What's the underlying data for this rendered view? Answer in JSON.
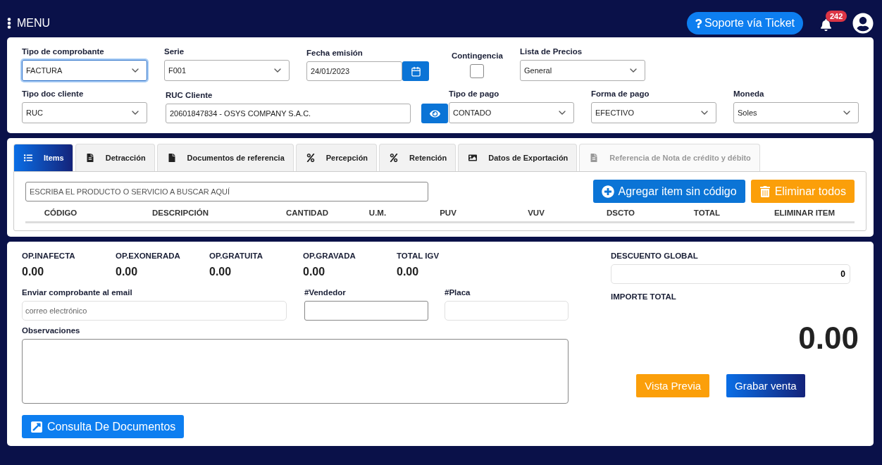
{
  "header": {
    "menu_label": "MENU",
    "support_button": "Soporte vía Ticket",
    "notifications_count": "242"
  },
  "form": {
    "rows": [
      [
        {
          "kind": "select",
          "label": "Tipo de comprobante",
          "value": "FACTURA",
          "focused": true
        },
        {
          "kind": "select",
          "label": "Serie",
          "value": "F001",
          "focused": false
        },
        {
          "kind": "date",
          "label": "Fecha emisión",
          "value": "24/01/2023"
        },
        {
          "kind": "checkbox",
          "label": "Contingencia",
          "checked": false
        },
        {
          "kind": "select",
          "label": "Lista de Precios",
          "value": "General",
          "focused": false
        }
      ],
      [
        {
          "kind": "select",
          "label": "Tipo doc cliente",
          "value": "RUC",
          "focused": false
        },
        {
          "kind": "text",
          "label": "RUC Cliente",
          "value": "20601847834 - OSYS COMPANY S.A.C."
        },
        {
          "kind": "eye-button"
        },
        {
          "kind": "select",
          "label": "Tipo de pago",
          "value": "CONTADO",
          "focused": false
        },
        {
          "kind": "select",
          "label": "Forma de pago",
          "value": "EFECTIVO",
          "focused": false
        },
        {
          "kind": "select",
          "label": "Moneda",
          "value": "Soles",
          "focused": false
        }
      ]
    ]
  },
  "tabs": [
    {
      "kind": "list",
      "label": "Items",
      "selected": true,
      "disabled": false
    },
    {
      "kind": "doc",
      "label": "Detracción",
      "selected": false,
      "disabled": false
    },
    {
      "kind": "file",
      "label": "Documentos de referencia",
      "selected": false,
      "disabled": false
    },
    {
      "kind": "percent",
      "label": "Percepción",
      "selected": false,
      "disabled": false
    },
    {
      "kind": "percent",
      "label": "Retención",
      "selected": false,
      "disabled": false
    },
    {
      "kind": "image",
      "label": "Datos de Exportación",
      "selected": false,
      "disabled": false
    },
    {
      "kind": "doc",
      "label": "Referencia de Nota de crédito y débito",
      "selected": false,
      "disabled": true
    }
  ],
  "items": {
    "search_placeholder": "ESCRIBA EL PRODUCTO O SERVICIO A BUSCAR AQUÍ",
    "add_button": "Agregar item sin código",
    "delete_all_button": "Eliminar todos",
    "columns": [
      "CÓDIGO",
      "DESCRIPCIÓN",
      "CANTIDAD",
      "U.M.",
      "PUV",
      "VUV",
      "DSCTO",
      "TOTAL",
      "ELIMINAR ITEM"
    ]
  },
  "totals": [
    {
      "label": "OP.INAFECTA",
      "value": "0.00"
    },
    {
      "label": "OP.EXONERADA",
      "value": "0.00"
    },
    {
      "label": "OP.GRATUITA",
      "value": "0.00"
    },
    {
      "label": "OP.GRAVADA",
      "value": "0.00"
    },
    {
      "label": "TOTAL IGV",
      "value": "0.00"
    }
  ],
  "email": {
    "label": "Enviar comprobante al email",
    "placeholder": "correo electrónico"
  },
  "vendedor": {
    "label": "#Vendedor"
  },
  "placa": {
    "label": "#Placa"
  },
  "observaciones": {
    "label": "Observaciones"
  },
  "consult_button": "Consulta De Documentos",
  "discount": {
    "label": "DESCUENTO GLOBAL",
    "value": "0"
  },
  "importe": {
    "label": "IMPORTE TOTAL",
    "value": "0.00"
  },
  "preview_button": "Vista Previa",
  "save_button": "Grabar venta"
}
